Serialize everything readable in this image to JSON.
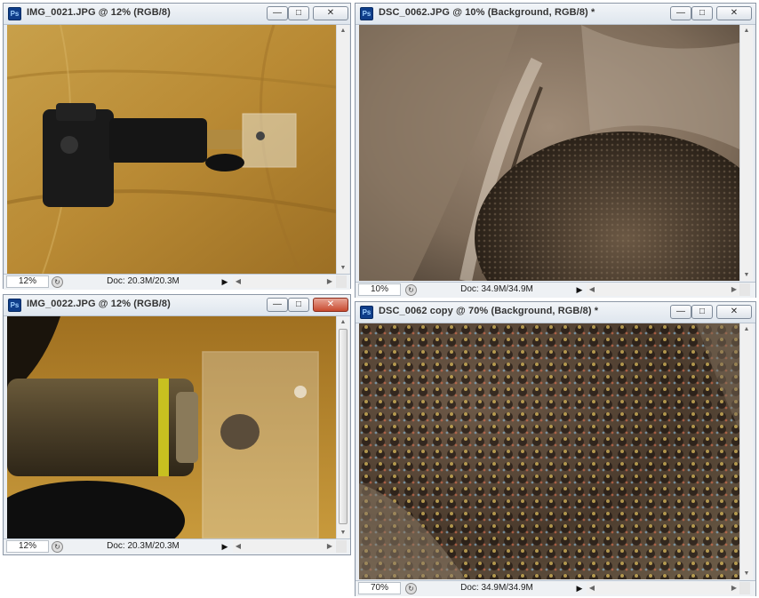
{
  "app_icon": "ps-icon",
  "windows": [
    {
      "title": "IMG_0021.JPG @ 12% (RGB/8)",
      "zoom": "12%",
      "doc": "Doc: 20.3M/20.3M",
      "buttons": {
        "minimize": "—",
        "maximize": "□",
        "close": "✕"
      }
    },
    {
      "title": "DSC_0062.JPG @ 10% (Background, RGB/8) *",
      "zoom": "10%",
      "doc": "Doc: 34.9M/34.9M",
      "buttons": {
        "minimize": "—",
        "maximize": "□",
        "close": "✕"
      }
    },
    {
      "title": "IMG_0022.JPG @ 12% (RGB/8)",
      "zoom": "12%",
      "doc": "Doc: 20.3M/20.3M",
      "buttons": {
        "minimize": "—",
        "maximize": "□",
        "close": "✕"
      }
    },
    {
      "title": "DSC_0062 copy @ 70% (Background, RGB/8) *",
      "zoom": "70%",
      "doc": "Doc: 34.9M/34.9M",
      "buttons": {
        "minimize": "—",
        "maximize": "□",
        "close": "✕"
      }
    }
  ],
  "ps_label": "Ps",
  "status_play": "▶",
  "scroll_left": "◀",
  "scroll_right": "▶",
  "scroll_up": "▲",
  "scroll_down": "▼",
  "nav_glyph": "↻",
  "colors": {
    "close_active": "#c84a2f",
    "title_text": "#333333",
    "frame": "#8c97a6"
  }
}
